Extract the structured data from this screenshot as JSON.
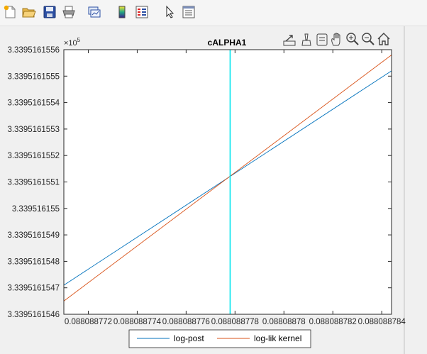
{
  "toolbar": {
    "buttons": [
      {
        "name": "new-figure-button",
        "icon": "new-figure-icon"
      },
      {
        "name": "open-file-button",
        "icon": "folder-open-icon"
      },
      {
        "name": "save-button",
        "icon": "save-icon"
      },
      {
        "name": "print-button",
        "icon": "printer-icon"
      },
      {
        "name": "link-plot-button",
        "icon": "link-plot-icon"
      },
      {
        "name": "insert-colorbar-button",
        "icon": "colorbar-icon"
      },
      {
        "name": "insert-legend-button",
        "icon": "legend-icon"
      },
      {
        "name": "edit-plot-button",
        "icon": "pointer-arrow-icon"
      },
      {
        "name": "property-inspector-button",
        "icon": "property-inspector-icon"
      }
    ]
  },
  "axes_toolbar": [
    "export-icon",
    "brush-icon",
    "data-tips-icon",
    "pan-hand-icon",
    "zoom-in-icon",
    "zoom-out-icon",
    "home-icon"
  ],
  "chart_data": {
    "type": "line",
    "title": "cALPHA1",
    "exponent_label": "×10",
    "exponent_power": "5",
    "x_ticks": [
      {
        "value": 0.088088772,
        "label": "0.088088772"
      },
      {
        "value": 0.088088774,
        "label": "0.088088774"
      },
      {
        "value": 0.088088776,
        "label": "0.088088776"
      },
      {
        "value": 0.088088778,
        "label": "0.088088778"
      },
      {
        "value": 0.08808878,
        "label": "0.08808878"
      },
      {
        "value": 0.088088782,
        "label": "0.088088782"
      },
      {
        "value": 0.088088784,
        "label": "0.088088784"
      }
    ],
    "y_ticks": [
      {
        "value": 3.3395161546,
        "label": "3.3395161546"
      },
      {
        "value": 3.3395161547,
        "label": "3.3395161547"
      },
      {
        "value": 3.3395161548,
        "label": "3.3395161548"
      },
      {
        "value": 3.3395161549,
        "label": "3.3395161549"
      },
      {
        "value": 3.339516155,
        "label": "3.339516155"
      },
      {
        "value": 3.3395161551,
        "label": "3.3395161551"
      },
      {
        "value": 3.3395161552,
        "label": "3.3395161552"
      },
      {
        "value": 3.3395161553,
        "label": "3.3395161553"
      },
      {
        "value": 3.3395161554,
        "label": "3.3395161554"
      },
      {
        "value": 3.3395161555,
        "label": "3.3395161555"
      },
      {
        "value": 3.3395161556,
        "label": "3.3395161556"
      }
    ],
    "xlim": [
      0.088088771,
      0.0880887844
    ],
    "ylim": [
      3.3395161546,
      3.3395161556
    ],
    "series": [
      {
        "name": "log-post",
        "color": "#0072BD",
        "x": [
          0.088088771,
          0.0880887844
        ],
        "y": [
          3.33951615471,
          3.33951615552
        ]
      },
      {
        "name": "log-lik kernel",
        "color": "#D95319",
        "x": [
          0.088088771,
          0.0880887844
        ],
        "y": [
          3.33951615465,
          3.33951615558
        ]
      }
    ],
    "vline": {
      "x": 0.0880887778,
      "color": "#00E5EE"
    },
    "legend": {
      "placement": "bottom-outside",
      "orientation": "horizontal"
    }
  }
}
